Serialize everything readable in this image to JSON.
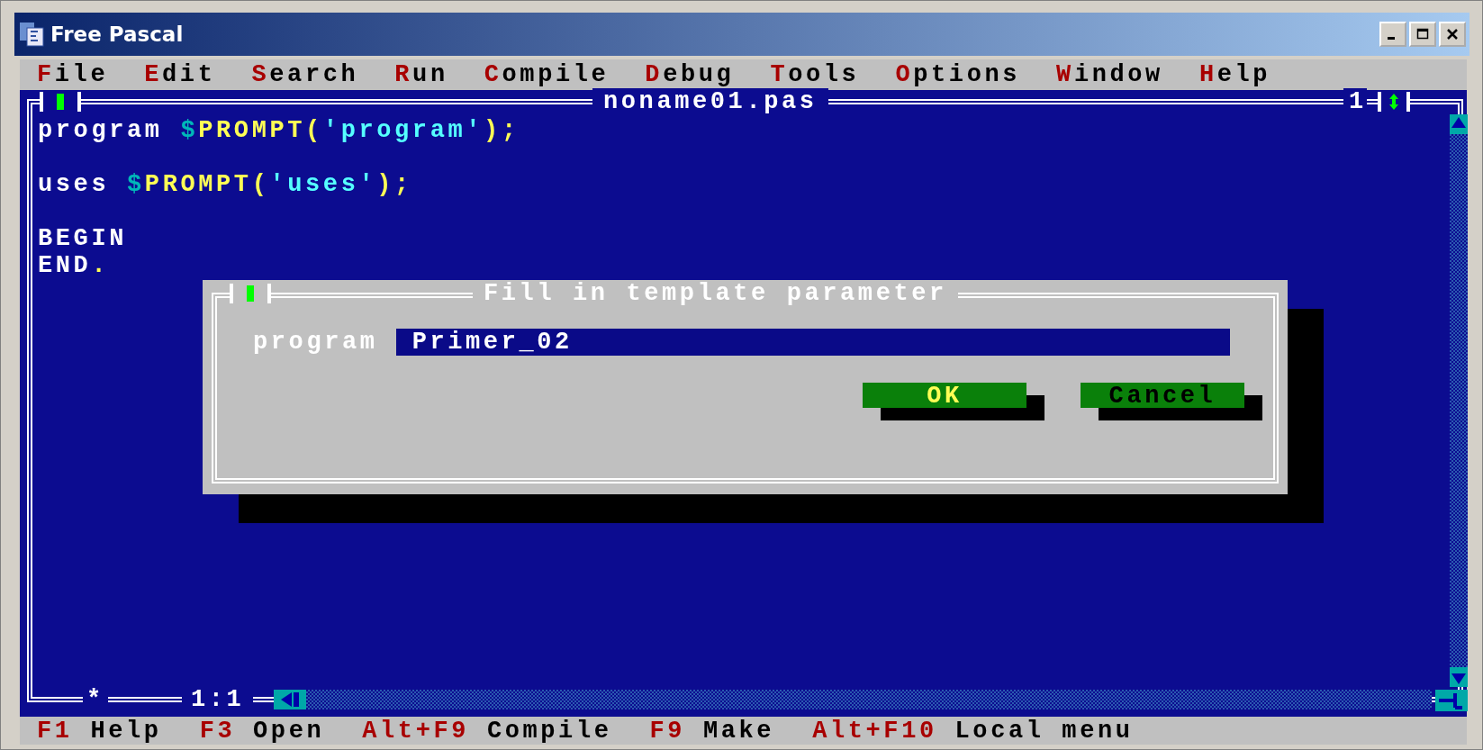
{
  "window": {
    "title": "Free Pascal"
  },
  "menu": [
    {
      "label": "File"
    },
    {
      "label": "Edit"
    },
    {
      "label": "Search"
    },
    {
      "label": "Run"
    },
    {
      "label": "Compile"
    },
    {
      "label": "Debug"
    },
    {
      "label": "Tools"
    },
    {
      "label": "Options"
    },
    {
      "label": "Window"
    },
    {
      "label": "Help"
    }
  ],
  "editor": {
    "title": "noname01.pas",
    "window_number": "1",
    "modified_mark": "*",
    "cursor_position": "1:1",
    "lines": [
      {
        "kind": "code",
        "tokens": [
          {
            "text": "program ",
            "kind": "keyword"
          },
          {
            "text": "$",
            "kind": "sigil"
          },
          {
            "text": "PROMPT(",
            "kind": "ident"
          },
          {
            "text": "'program'",
            "kind": "string"
          },
          {
            "text": ");",
            "kind": "symbol"
          }
        ]
      },
      {
        "kind": "blank"
      },
      {
        "kind": "code",
        "tokens": [
          {
            "text": "uses ",
            "kind": "keyword"
          },
          {
            "text": "$",
            "kind": "sigil"
          },
          {
            "text": "PROMPT(",
            "kind": "ident"
          },
          {
            "text": "'uses'",
            "kind": "string"
          },
          {
            "text": ");",
            "kind": "symbol"
          }
        ]
      },
      {
        "kind": "blank"
      },
      {
        "kind": "code",
        "tokens": [
          {
            "text": "BEGIN",
            "kind": "keyword"
          }
        ]
      },
      {
        "kind": "code",
        "tokens": [
          {
            "text": "END",
            "kind": "keyword"
          },
          {
            "text": ".",
            "kind": "symbol"
          }
        ]
      }
    ]
  },
  "dialog": {
    "title": "Fill in template parameter",
    "field_label": "program",
    "field_value": "Primer_02",
    "buttons": [
      {
        "label": "OK",
        "default": true
      },
      {
        "label": "Cancel",
        "default": false
      }
    ]
  },
  "status_bar": [
    {
      "key": "F1",
      "label": "Help"
    },
    {
      "key": "F3",
      "label": "Open"
    },
    {
      "key": "Alt+F9",
      "label": "Compile"
    },
    {
      "key": "F9",
      "label": "Make"
    },
    {
      "key": "Alt+F10",
      "label": "Local menu"
    }
  ]
}
